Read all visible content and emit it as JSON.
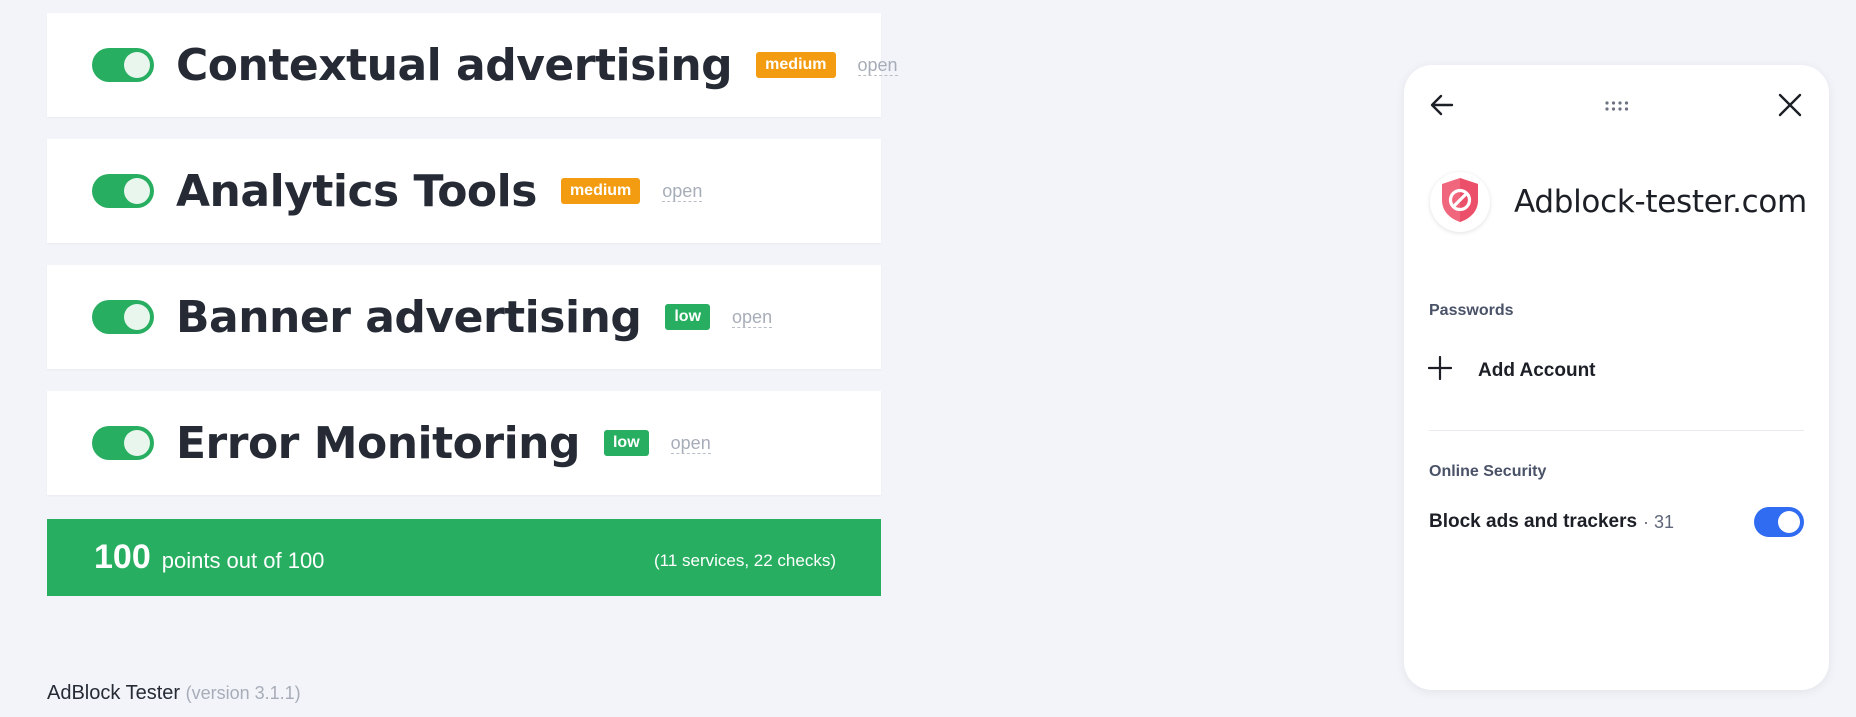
{
  "tests": [
    {
      "title": "Contextual advertising",
      "severity": "medium",
      "severity_color": "#f39c12",
      "link": "open",
      "enabled": true
    },
    {
      "title": "Analytics Tools",
      "severity": "medium",
      "severity_color": "#f39c12",
      "link": "open",
      "enabled": true
    },
    {
      "title": "Banner advertising",
      "severity": "low",
      "severity_color": "#27ae60",
      "link": "open",
      "enabled": true
    },
    {
      "title": "Error Monitoring",
      "severity": "low",
      "severity_color": "#27ae60",
      "link": "open",
      "enabled": true
    }
  ],
  "score": {
    "points": "100",
    "text": "points out of 100",
    "meta": "(11 services, 22 checks)",
    "color": "#27ae60"
  },
  "footer": {
    "name": "AdBlock Tester",
    "version": "(version 3.1.1)"
  },
  "panel": {
    "site": "Adblock-tester.com",
    "passwords_label": "Passwords",
    "add_account": "Add Account",
    "security_label": "Online Security",
    "block_label": "Block ads and trackers",
    "block_count": "· 31",
    "block_enabled": true,
    "accent": "#2f6cf1",
    "icons": [
      "back-arrow-icon",
      "drag-handle-icon",
      "close-icon",
      "shield-block-icon",
      "plus-icon"
    ]
  }
}
